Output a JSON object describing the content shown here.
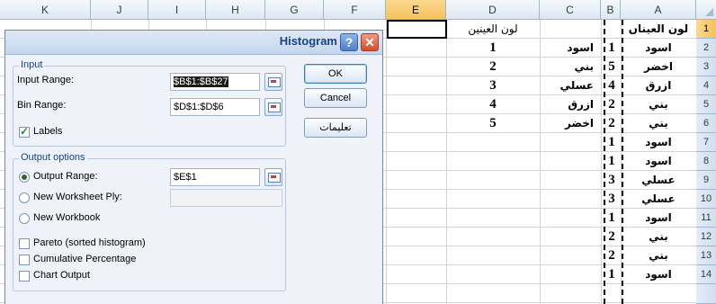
{
  "sheet": {
    "columns": [
      {
        "letter": "A",
        "selected": false
      },
      {
        "letter": "B",
        "selected": false
      },
      {
        "letter": "C",
        "selected": false
      },
      {
        "letter": "D",
        "selected": false
      },
      {
        "letter": "E",
        "selected": true
      },
      {
        "letter": "F",
        "selected": false
      },
      {
        "letter": "G",
        "selected": false
      },
      {
        "letter": "H",
        "selected": false
      },
      {
        "letter": "I",
        "selected": false
      },
      {
        "letter": "J",
        "selected": false
      },
      {
        "letter": "K",
        "selected": false
      }
    ],
    "rows": [
      "1",
      "2",
      "3",
      "4",
      "5",
      "6",
      "7",
      "8",
      "9",
      "10",
      "11",
      "12",
      "13",
      "14"
    ],
    "selected_row": "1",
    "col_A": [
      "لون العيناں",
      "اسود",
      "اخضر",
      "ازرق",
      "بني",
      "بني",
      "اسود",
      "اسود",
      "عسلي",
      "عسلي",
      "اسود",
      "بني",
      "بني",
      "اسود"
    ],
    "col_B": [
      "",
      "1",
      "5",
      "4",
      "2",
      "2",
      "1",
      "1",
      "3",
      "3",
      "1",
      "2",
      "2",
      "1"
    ],
    "col_C": [
      "",
      "اسود",
      "بني",
      "عسلي",
      "ازرق",
      "اخضر"
    ],
    "col_D": [
      "لون العينين",
      "1",
      "2",
      "3",
      "4",
      "5"
    ]
  },
  "dialog": {
    "title": "Histogram",
    "help_glyph": "?",
    "close_glyph": "✕",
    "input": {
      "group_title": "Input",
      "input_range_label": "Input Range:",
      "input_range_value": "$B$1:$B$27",
      "bin_range_label": "Bin Range:",
      "bin_range_value": "$D$1:$D$6",
      "labels_label": "Labels",
      "labels_checked": true
    },
    "buttons": {
      "ok": "OK",
      "cancel": "Cancel",
      "help": "تعليمات"
    },
    "output": {
      "group_title": "Output options",
      "output_range_label": "Output Range:",
      "output_range_value": "$E$1",
      "new_ply_label": "New Worksheet Ply:",
      "new_ply_value": "",
      "new_workbook_label": "New Workbook",
      "selected_option": "Output Range",
      "pareto_label": "Pareto (sorted histogram)",
      "cumulative_label": "Cumulative Percentage",
      "chart_label": "Chart Output",
      "pareto_checked": false,
      "cumulative_checked": false,
      "chart_checked": false
    }
  }
}
